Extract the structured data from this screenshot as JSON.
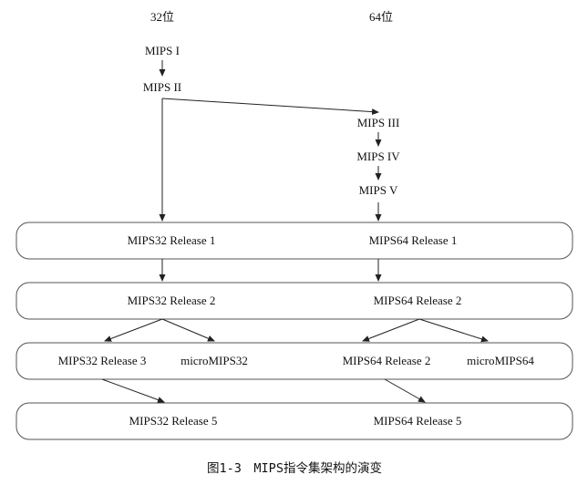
{
  "columns": {
    "left": "32位",
    "right": "64位"
  },
  "nodes": {
    "mips1": "MIPS I",
    "mips2": "MIPS II",
    "mips3": "MIPS III",
    "mips4": "MIPS IV",
    "mips5": "MIPS V",
    "r32_1": "MIPS32 Release 1",
    "r64_1": "MIPS64 Release 1",
    "r32_2": "MIPS32 Release 2",
    "r64_2": "MIPS64 Release 2",
    "r32_3": "MIPS32 Release 3",
    "micro32": "microMIPS32",
    "r64_2b": "MIPS64 Release 2",
    "micro64": "microMIPS64",
    "r32_5": "MIPS32 Release 5",
    "r64_5": "MIPS64 Release 5"
  },
  "caption": "图1-3　MIPS指令集架构的演变"
}
